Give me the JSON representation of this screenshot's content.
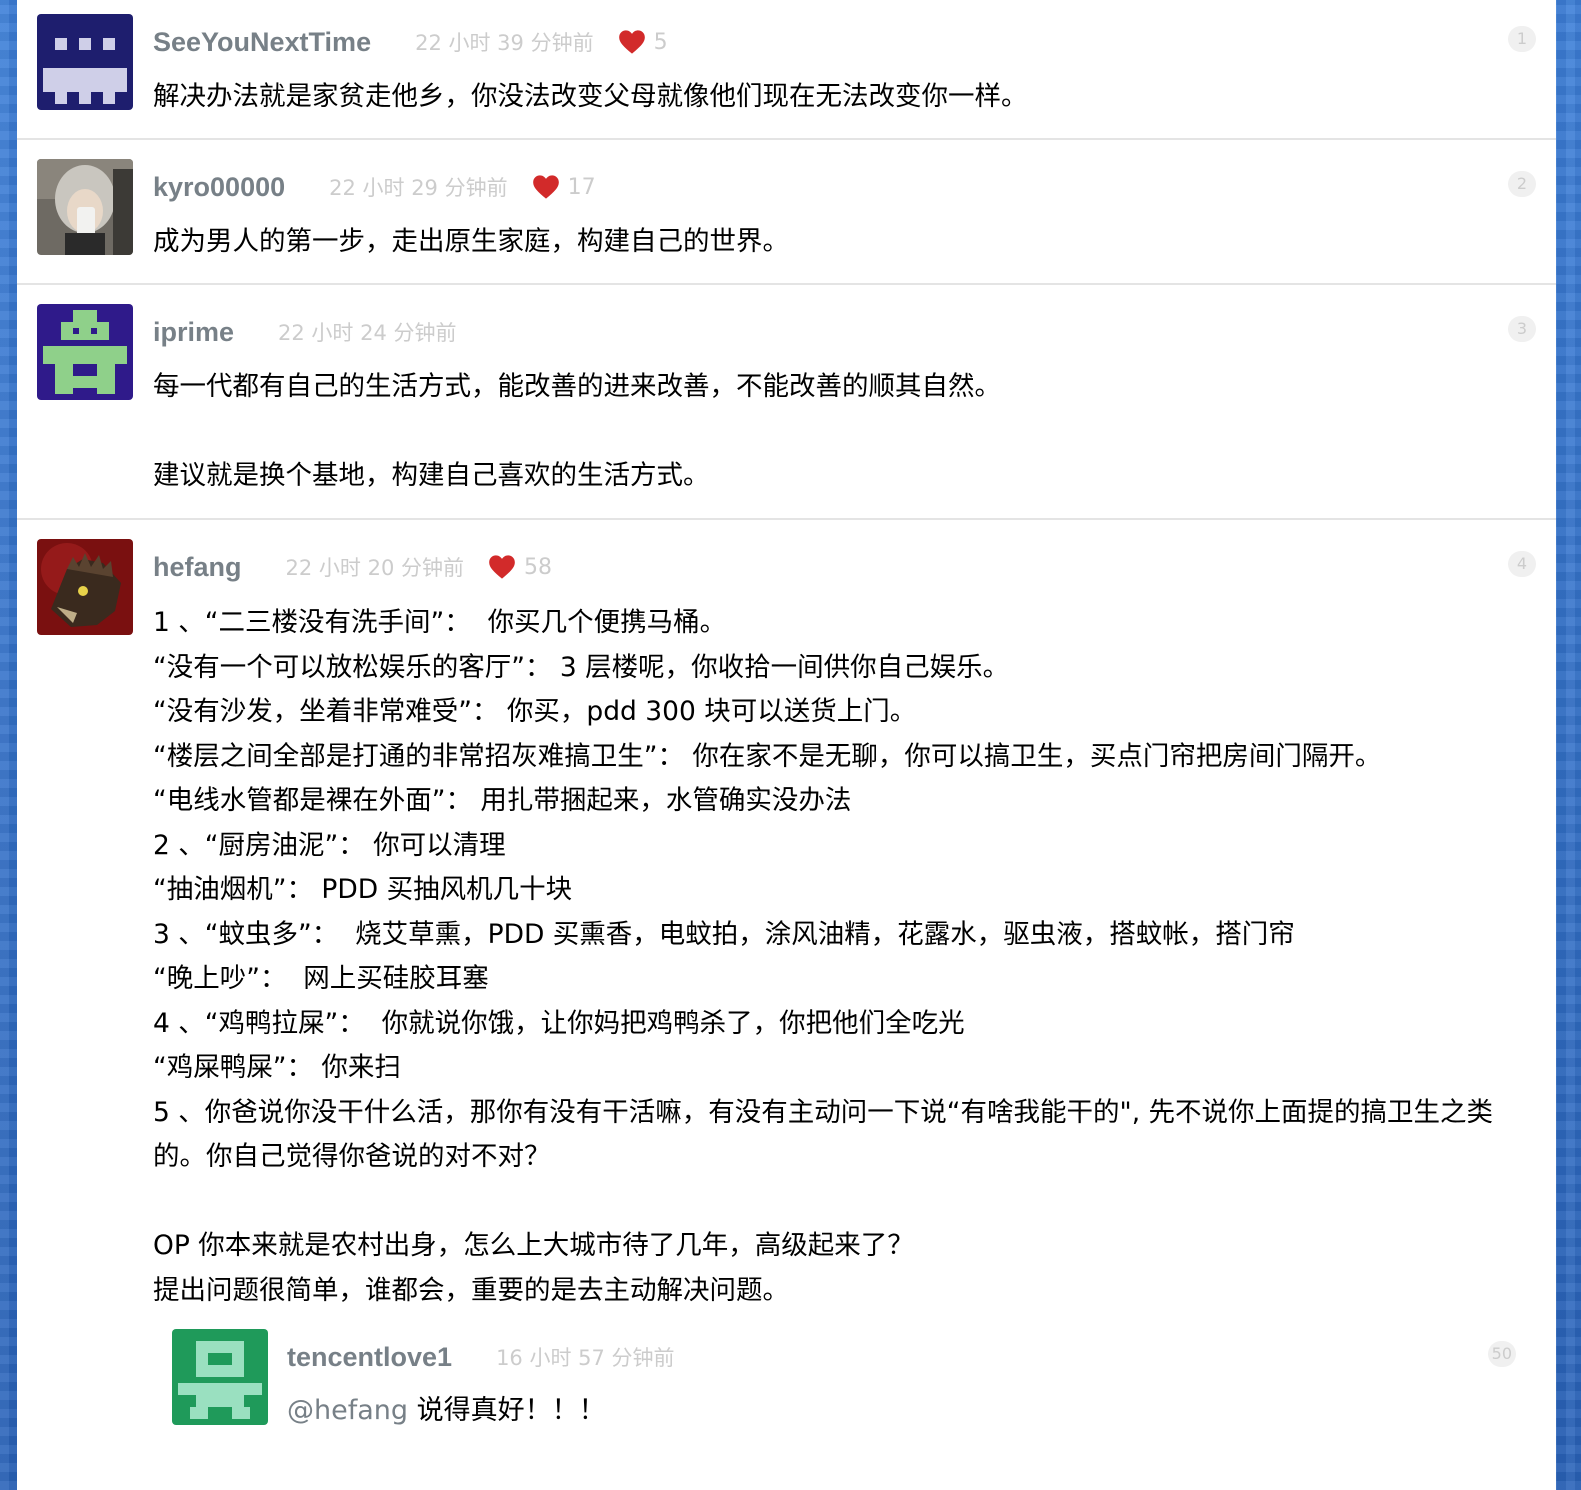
{
  "colors": {
    "background": "#2f6fc8",
    "panel": "#ffffff",
    "username": "#778087",
    "meta": "#cccccc",
    "heart": "#d22a2a",
    "divider": "#e4e4e4"
  },
  "replies": [
    {
      "username": "SeeYouNextTime",
      "ago": "22 小时 39 分钟前",
      "likes": "5",
      "floor": "1",
      "avatar_icon": "pixel-avatar-navy",
      "lines": [
        "解决办法就是家贫走他乡，你没法改变父母就像他们现在无法改变你一样。"
      ]
    },
    {
      "username": "kyro00000",
      "ago": "22 小时 29 分钟前",
      "likes": "17",
      "floor": "2",
      "avatar_icon": "photo-avatar",
      "lines": [
        "成为男人的第一步，走出原生家庭，构建自己的世界。"
      ]
    },
    {
      "username": "iprime",
      "ago": "22 小时 24 分钟前",
      "likes": "",
      "floor": "3",
      "avatar_icon": "pixel-avatar-green-purple",
      "lines": [
        "每一代都有自己的生活方式，能改善的进来改善，不能改善的顺其自然。",
        "",
        "建议就是换个基地，构建自己喜欢的生活方式。"
      ]
    },
    {
      "username": "hefang",
      "ago": "22 小时 20 分钟前",
      "likes": "58",
      "floor": "4",
      "avatar_icon": "beast-avatar",
      "lines": [
        "1 、“二三楼没有洗手间”：  你买几个便携马桶。",
        "“没有一个可以放松娱乐的客厅”： 3 层楼呢，你收拾一间供你自己娱乐。",
        "“没有沙发，坐着非常难受”： 你买，pdd 300 块可以送货上门。",
        "“楼层之间全部是打通的非常招灰难搞卫生”： 你在家不是无聊，你可以搞卫生，买点门帘把房间门隔开。",
        "“电线水管都是裸在外面”： 用扎带捆起来，水管确实没办法",
        "2 、“厨房油泥”： 你可以清理",
        "“抽油烟机”： PDD 买抽风机几十块",
        "3 、“蚊虫多”：  烧艾草熏，PDD 买熏香，电蚊拍，涂风油精，花露水，驱虫液，搭蚊帐，搭门帘",
        "“晚上吵”：  网上买硅胶耳塞",
        "4 、“鸡鸭拉屎”：  你就说你饿，让你妈把鸡鸭杀了，你把他们全吃光",
        "“鸡屎鸭屎”： 你来扫",
        "5 、你爸说你没干什么活，那你有没有干活嘛，有没有主动问一下说“有啥我能干的\", 先不说你上面提的搞卫生之类的。你自己觉得你爸说的对不对？",
        "",
        "OP 你本来就是农村出身，怎么上大城市待了几年，高级起来了？",
        "提出问题很简单，谁都会，重要的是去主动解决问题。"
      ],
      "nested": {
        "username": "tencentlove1",
        "ago": "16 小时 57 分钟前",
        "floor": "50",
        "avatar_icon": "pixel-avatar-green",
        "mention": "@hefang",
        "text": " 说得真好！！！"
      }
    }
  ]
}
